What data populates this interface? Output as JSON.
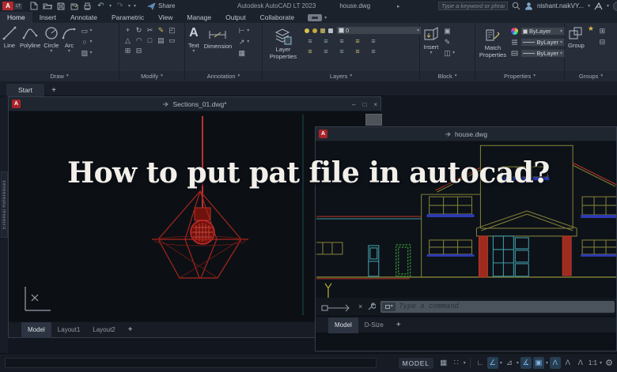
{
  "ui": {
    "dropdown": "▾",
    "caret_right": "▸",
    "star": "★"
  },
  "titlebar": {
    "logo_letter": "A",
    "logo_lt": "LT",
    "undo_glyph": "↶",
    "redo_glyph": "↷",
    "share_label": "Share",
    "app_title": "Autodesk AutoCAD LT 2023",
    "doc_name": "house.dwg",
    "search_placeholder": "Type a keyword or phrase",
    "user_name": "nishant.naikVY..."
  },
  "ribbon": {
    "tabs": [
      "Home",
      "Insert",
      "Annotate",
      "Parametric",
      "View",
      "Manage",
      "Output",
      "Collaborate"
    ],
    "draw": {
      "label": "Draw",
      "line": "Line",
      "polyline": "Polyline",
      "circle": "Circle",
      "arc": "Arc",
      "minis": [
        "▭",
        "○",
        "▨"
      ]
    },
    "modify": {
      "label": "Modify",
      "glyphs": [
        "+",
        "↻",
        "✂",
        "✎",
        "◰",
        "△",
        "◠",
        "□",
        "▤",
        "▭",
        "⊞",
        "⊟"
      ]
    },
    "annotation": {
      "label": "Annotation",
      "text_glyph": "A",
      "text_label": "Text",
      "dimension": "Dimension",
      "minis": [
        "⊢",
        "↗",
        "▦"
      ]
    },
    "layers": {
      "label": "Layers",
      "big_label": "Layer Properties",
      "current": "0",
      "grid_glyph": "≡"
    },
    "block": {
      "label": "Block",
      "insert": "Insert",
      "minis": [
        "▣",
        "✎",
        "◫"
      ]
    },
    "properties": {
      "label": "Properties",
      "match": "Match Properties",
      "color": "ByLayer",
      "linetype": "ByLayer",
      "lineweight": "ByLayer"
    },
    "groups": {
      "label": "Groups",
      "group": "Group",
      "minis": [
        "⊞",
        "⊟"
      ]
    }
  },
  "file_tabs": {
    "start": "Start",
    "add": "+"
  },
  "sections_window": {
    "title": "Sections_01.dwg*",
    "minimize": "–",
    "restore": "□",
    "close": "×",
    "tabs": [
      "Model",
      "Layout1",
      "Layout2"
    ],
    "add_tab": "+"
  },
  "house_window": {
    "title": "house.dwg",
    "close": "×",
    "command_placeholder": "Type a command",
    "tabs": [
      "Model",
      "D-Size"
    ],
    "add_tab": "+"
  },
  "overlay_title": "How to put pat file in autocad?",
  "left_palette": "External References",
  "statusbar": {
    "model": "MODEL",
    "scale": "1:1",
    "icons": {
      "grid": "▦",
      "snap": "∷",
      "ortho": "∟",
      "polar": "∠",
      "isodraft": "⊿",
      "osnap_track": "∡",
      "osnap": "▣",
      "annotation": "Λ",
      "autoscale": "Λ",
      "annoscale": "Λ",
      "gear": "⚙"
    }
  },
  "colors": {
    "accent_red": "#b02a30",
    "highlight_blue": "#5d94c8",
    "wire_red": "#b5291f",
    "house_olive": "#7c7c35",
    "house_cyan": "#3e9aa5",
    "house_green": "#3aa23a",
    "house_blue": "#2c3bb3"
  }
}
